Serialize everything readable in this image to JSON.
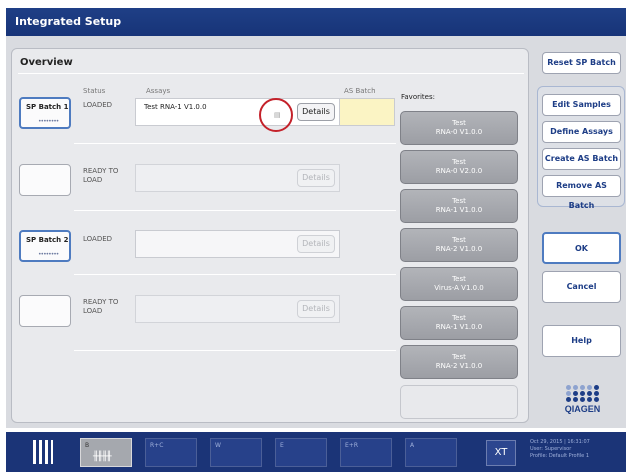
{
  "title": "Integrated Setup",
  "overview": {
    "title": "Overview",
    "headers": {
      "status": "Status",
      "assays": "Assays",
      "as_batch": "AS Batch"
    },
    "favorites_label": "Favorites:"
  },
  "rows": [
    {
      "sp_label": "SP Batch 1",
      "sp_dots": "••••••••",
      "status": "LOADED",
      "assay": "Test RNA-1 V1.0.0",
      "details": "Details"
    },
    {
      "sp_label": "",
      "sp_dots": "",
      "status": "READY TO LOAD",
      "assay": "",
      "details": "Details"
    },
    {
      "sp_label": "SP Batch 2",
      "sp_dots": "••••••••",
      "status": "LOADED",
      "assay": "",
      "details": "Details"
    },
    {
      "sp_label": "",
      "sp_dots": "",
      "status": "READY TO LOAD",
      "assay": "",
      "details": "Details"
    }
  ],
  "favorites": [
    {
      "line1": "Test",
      "line2": "RNA-0 V1.0.0"
    },
    {
      "line1": "Test",
      "line2": "RNA-0 V2.0.0"
    },
    {
      "line1": "Test",
      "line2": "RNA-1 V1.0.0"
    },
    {
      "line1": "Test",
      "line2": "RNA-2 V1.0.0"
    },
    {
      "line1": "Test",
      "line2": "Virus-A V1.0.0"
    },
    {
      "line1": "Test",
      "line2": "RNA-1 V1.0.0"
    },
    {
      "line1": "Test",
      "line2": "RNA-2 V1.0.0"
    }
  ],
  "right": {
    "reset": "Reset SP Batch",
    "edit": "Edit Samples",
    "define": "Define Assays",
    "create": "Create AS Batch",
    "remove": "Remove AS Batch",
    "ok": "OK",
    "cancel": "Cancel",
    "help": "Help"
  },
  "logo": "QIAGEN",
  "bottom": {
    "slots": [
      "B",
      "R+C",
      "W",
      "E",
      "E+R",
      "A"
    ],
    "xt": "XT",
    "info_line1": "Oct 29, 2015 | 16:31:07",
    "info_line2": "User:    Supervisor",
    "info_line3": "Profile:   Default Profile 1"
  },
  "colors": {
    "title_bar": "#1f3f86",
    "accent": "#1d3d86",
    "highlight": "#c4212a",
    "as_batch": "#fbf4c4"
  }
}
